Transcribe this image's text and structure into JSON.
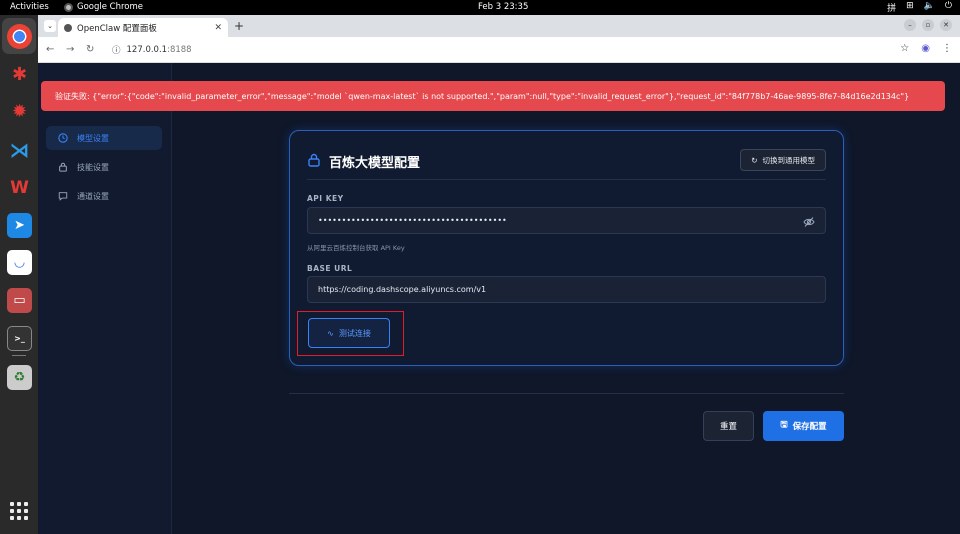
{
  "system": {
    "activities": "Activities",
    "app_name": "Google Chrome",
    "clock": "Feb 3  23:35"
  },
  "browser": {
    "tab_title": "OpenClaw 配置面板",
    "url_host": "127.0.0.1",
    "url_port": ":8188"
  },
  "error": {
    "message": "验证失败: {\"error\":{\"code\":\"invalid_parameter_error\",\"message\":\"model `qwen-max-latest` is not supported.\",\"param\":null,\"type\":\"invalid_request_error\"},\"request_id\":\"84f778b7-46ae-9895-8fe7-84d16e2d134c\"}"
  },
  "sidebar": {
    "items": [
      {
        "label": "模型设置",
        "icon": "clock-icon",
        "active": true
      },
      {
        "label": "技能设置",
        "icon": "lock-icon",
        "active": false
      },
      {
        "label": "通道设置",
        "icon": "chat-icon",
        "active": false
      }
    ]
  },
  "card": {
    "title": "百炼大模型配置",
    "switch_label": "切换到通用模型",
    "api_key_label": "API KEY",
    "api_key_value": "••••••••••••••••••••••••••••••••••••••••",
    "api_key_hint": "从阿里云百炼控制台获取 API Key",
    "base_url_label": "BASE URL",
    "base_url_value": "https://coding.dashscope.aliyuncs.com/v1",
    "test_label": "测试连接"
  },
  "actions": {
    "reset_label": "重置",
    "save_label": "保存配置"
  },
  "colors": {
    "accent": "#3b82f6",
    "error": "#e5484d",
    "save": "#1f6fe5"
  }
}
